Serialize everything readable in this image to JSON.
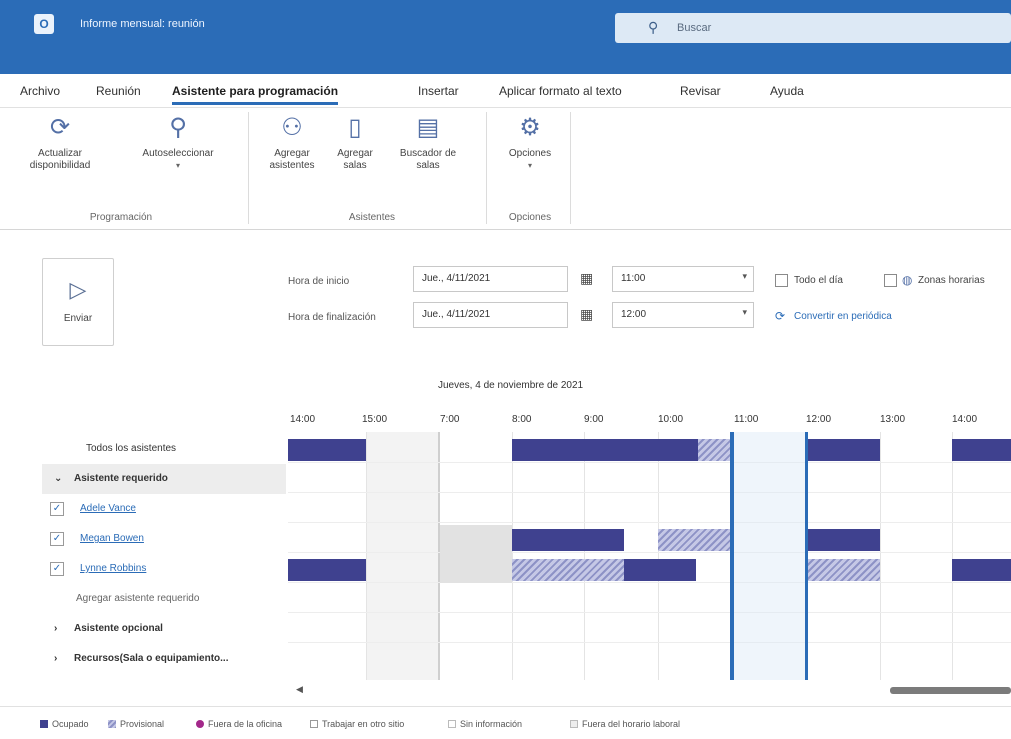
{
  "window": {
    "title": "Informe mensual: reunión"
  },
  "search": {
    "placeholder": "Buscar"
  },
  "tabs": [
    "Archivo",
    "Reunión",
    "Asistente para programación",
    "Insertar",
    "Aplicar formato al texto",
    "Revisar",
    "Ayuda"
  ],
  "ribbon": {
    "refresh_label": "Actualizar disponibilidad",
    "autoselect_label": "Autoseleccionar",
    "group1_label": "Programación",
    "add_attendees_label": "Agregar asistentes",
    "add_rooms_label": "Agregar salas",
    "room_finder_label": "Buscador de salas",
    "group2_label": "Asistentes",
    "options_label": "Opciones",
    "group3_label": "Opciones"
  },
  "send": {
    "label": "Enviar"
  },
  "time": {
    "start_label": "Hora de inicio",
    "end_label": "Hora de finalización",
    "start_date": "Jue., 4/11/2021",
    "start_time": "11:00",
    "end_date": "Jue., 4/11/2021",
    "end_time": "12:00",
    "all_day": "Todo el día",
    "time_zones": "Zonas horarias",
    "recurrence": "Convertir en periódica"
  },
  "scheduler": {
    "date_header": "Jueves, 4 de noviembre de 2021",
    "hours": [
      "14:00",
      "15:00",
      "7:00",
      "8:00",
      "9:00",
      "10:00",
      "11:00",
      "12:00",
      "13:00",
      "14:00"
    ]
  },
  "attendees": {
    "all": "Todos los asistentes",
    "required_header": "Asistente requerido",
    "people": [
      "Adele Vance",
      "Megan Bowen",
      "Lynne Robbins"
    ],
    "add_required": "Agregar asistente requerido",
    "optional_header": "Asistente opcional",
    "resources_header": "Recursos(Sala o equipamiento..."
  },
  "legend": [
    "Ocupado",
    "Provisional",
    "Fuera de la oficina",
    "Trabajar en otro sitio",
    "Sin información",
    "Fuera del horario laboral"
  ],
  "colors": {
    "accent": "#2b6cb7",
    "busy": "#3f418f",
    "tentative": "#8d92c6",
    "oof": "#a3288a"
  }
}
